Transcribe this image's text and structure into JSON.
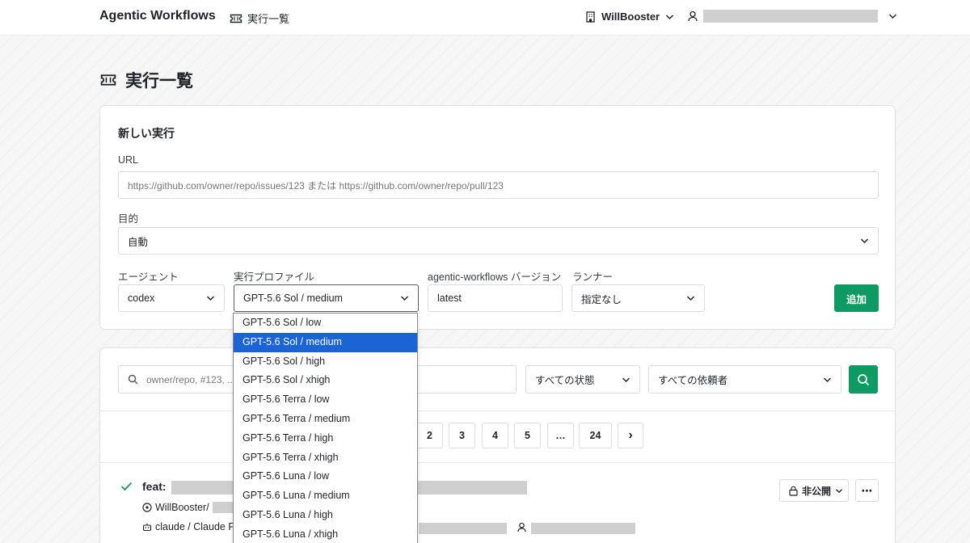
{
  "header": {
    "brand": "Agentic Workflows",
    "crumb": "実行一覧",
    "org": "WillBooster"
  },
  "page_title": "実行一覧",
  "new_run": {
    "title": "新しい実行",
    "url_label": "URL",
    "url_placeholder": "https://github.com/owner/repo/issues/123 または https://github.com/owner/repo/pull/123",
    "purpose_label": "目的",
    "purpose_value": "自動",
    "agent_label": "エージェント",
    "agent_value": "codex",
    "profile_label": "実行プロファイル",
    "profile_value": "GPT-5.6 Sol / medium",
    "version_label": "agentic-workflows バージョン",
    "version_value": "latest",
    "runner_label": "ランナー",
    "runner_value": "指定なし",
    "add_label": "追加"
  },
  "filters": {
    "search_placeholder": "owner/repo, #123, ...",
    "status_value": "すべての状態",
    "requester_value": "すべての依頼者"
  },
  "pagination": {
    "pages": [
      "2",
      "3",
      "4",
      "5",
      "…",
      "24"
    ],
    "next": "›"
  },
  "run_item": {
    "title_prefix": "feat:",
    "repo_prefix": "WillBooster/",
    "agent_prefix": "claude / Claude Fa",
    "visibility_label": "非公開",
    "more_label": "⋯"
  },
  "profile_options": [
    "GPT-5.6 Sol / low",
    "GPT-5.6 Sol / medium",
    "GPT-5.6 Sol / high",
    "GPT-5.6 Sol / xhigh",
    "GPT-5.6 Terra / low",
    "GPT-5.6 Terra / medium",
    "GPT-5.6 Terra / high",
    "GPT-5.6 Terra / xhigh",
    "GPT-5.6 Luna / low",
    "GPT-5.6 Luna / medium",
    "GPT-5.6 Luna / high",
    "GPT-5.6 Luna / xhigh"
  ],
  "selected_option_index": 1,
  "colors": {
    "accent_green": "#0e9a63",
    "selection_blue": "#1a64d6"
  },
  "icons": [
    "ticket-icon",
    "building-icon",
    "user-icon",
    "chevron-down-icon",
    "search-icon",
    "check-icon",
    "repo-icon",
    "robot-icon",
    "lock-icon"
  ]
}
